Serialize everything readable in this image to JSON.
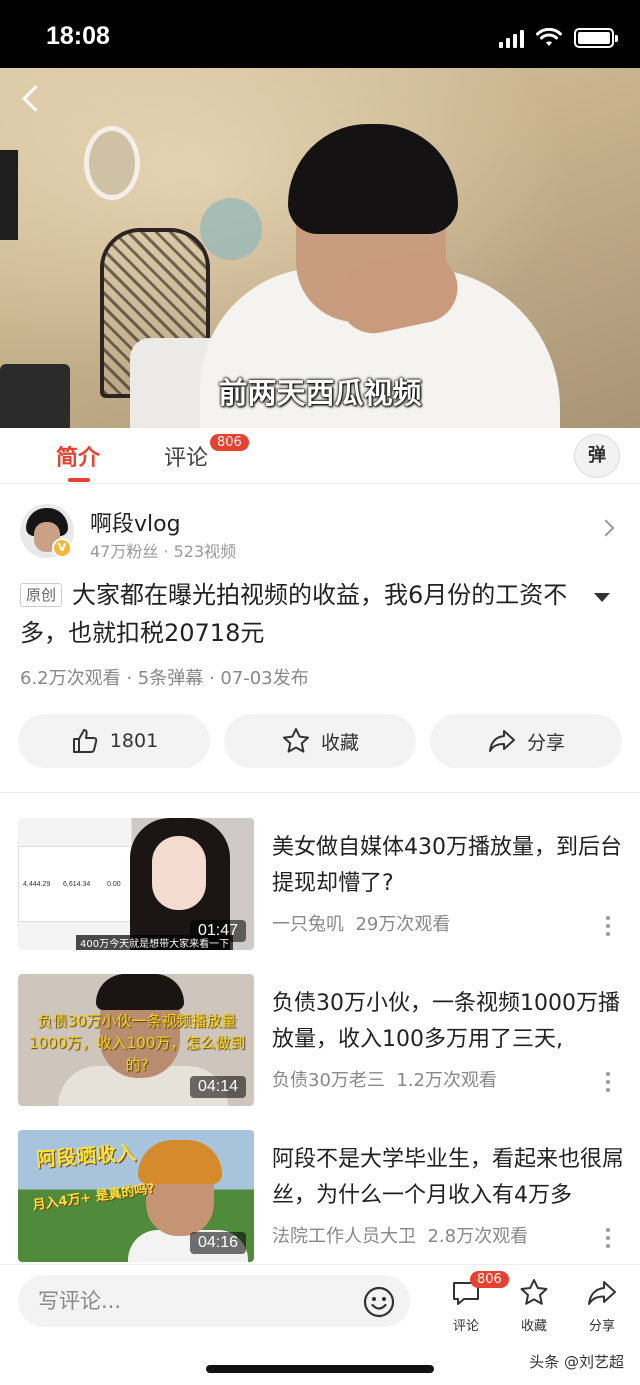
{
  "status_bar": {
    "time": "18:08"
  },
  "video": {
    "subtitle": "前两天西瓜视频"
  },
  "tabs": {
    "intro_label": "简介",
    "comments_label": "评论",
    "comments_count": "806",
    "danmaku_label": "弹"
  },
  "author": {
    "name": "啊段vlog",
    "stats": "47万粉丝 · 523视频",
    "verified_mark": "V"
  },
  "video_info": {
    "original_tag": "原创",
    "title": "大家都在曝光拍视频的收益，我6月份的工资不多，也就扣税20718元",
    "meta": "6.2万次观看 · 5条弹幕 · 07-03发布"
  },
  "actions": {
    "like_count": "1801",
    "favorite_label": "收藏",
    "share_label": "分享"
  },
  "related": [
    {
      "title": "美女做自媒体430万播放量，到后台提现却懵了?",
      "author": "一只兔叽",
      "views": "29万次观看",
      "duration": "01:47",
      "thumb_caption": "400万今天就是想带大家来看一下",
      "thumb_doc": [
        "4,444.29",
        "6,614.34",
        "0.00"
      ]
    },
    {
      "title": "负债30万小伙，一条视频1000万播放量，收入100多万用了三天,",
      "author": "负债30万老三",
      "views": "1.2万次观看",
      "duration": "04:14",
      "thumb_caption": "负债30万小伙一条视频播放量1000万，收入100万，怎么做到的?"
    },
    {
      "title": "阿段不是大学毕业生，看起来也很屌丝，为什么一个月收入有4万多",
      "author": "法院工作人员大卫",
      "views": "2.8万次观看",
      "duration": "04:16",
      "thumb_caption_1": "阿段晒收入",
      "thumb_caption_2": "月入4万+ 是真的吗?"
    }
  ],
  "bottom_bar": {
    "comment_placeholder": "写评论...",
    "comment_label": "评论",
    "comment_count": "806",
    "favorite_label": "收藏",
    "share_label": "分享",
    "watermark": "头条 @刘艺超"
  },
  "colors": {
    "accent": "#e8412f",
    "verified": "#f4b73b"
  }
}
